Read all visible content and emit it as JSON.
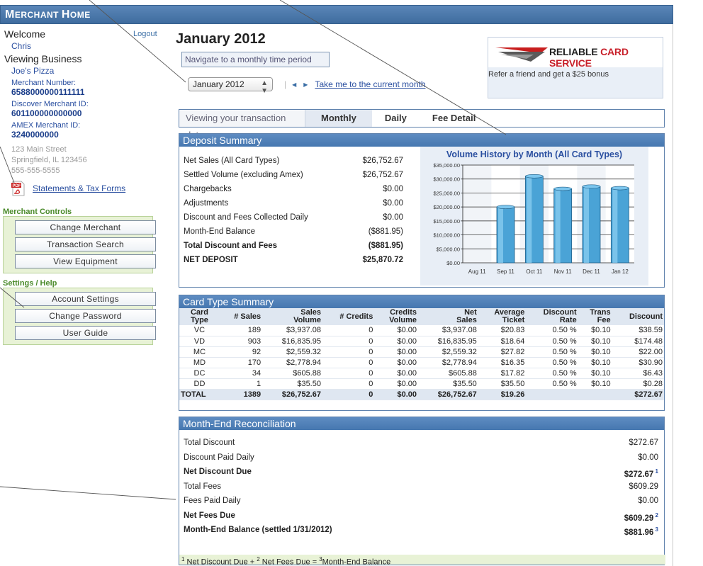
{
  "app": {
    "title_big": "M",
    "title_rest": "ERCHANT ",
    "title_big2": "H",
    "title_rest2": "OME"
  },
  "sidebar": {
    "welcome": "Welcome",
    "logout": "Logout",
    "user": "Chris",
    "viewing_business": "Viewing Business",
    "business_name": "Joe's Pizza",
    "merchant_number_label": "Merchant Number:",
    "merchant_number": "6588000000111111",
    "discover_label": "Discover Merchant ID:",
    "discover_id": "601100000000000",
    "amex_label": "AMEX Merchant ID:",
    "amex_id": "3240000000",
    "address1": "123 Main Street",
    "address2": "Springfield, IL 123456",
    "phone": "555-555-5555",
    "statements_link": "Statements & Tax Forms",
    "merchant_controls_title": "Merchant Controls",
    "merchant_controls": [
      "Change Merchant",
      "Transaction Search",
      "View Equipment"
    ],
    "settings_title": "Settings / Help",
    "settings": [
      "Account Settings",
      "Change Password",
      "User Guide"
    ]
  },
  "header": {
    "month_title": "January 2012",
    "nav_hint": "Navigate to a monthly time period",
    "month_select": "January 2012",
    "current_month_link": "Take me to the current month",
    "separator": "|"
  },
  "ad": {
    "brand1": "RELIABLE",
    "brand2": " CARD SERVICE",
    "tagline": "Refer a friend and get a $25 bonus"
  },
  "view_tabs": {
    "label": "Viewing your transaction data",
    "tabs": [
      "Monthly",
      "Daily",
      "Fee Detail"
    ],
    "active": "Monthly"
  },
  "deposit": {
    "title": "Deposit Summary",
    "rows": [
      {
        "label": "Net Sales (All Card Types)",
        "value": "$26,752.67"
      },
      {
        "label": "Settled Volume (excluding Amex)",
        "value": "$26,752.67"
      },
      {
        "label": "Chargebacks",
        "value": "$0.00"
      },
      {
        "label": "Adjustments",
        "value": "$0.00"
      },
      {
        "label": "Discount and Fees Collected Daily",
        "value": "$0.00"
      },
      {
        "label": "Month-End Balance",
        "value": "($881.95)"
      },
      {
        "label": "Total Discount and Fees",
        "value": "($881.95)"
      },
      {
        "label": "NET DEPOSIT",
        "value": "$25,870.72"
      }
    ]
  },
  "chart_data": {
    "type": "bar",
    "title": "Volume History by Month (All Card Types)",
    "categories": [
      "Aug 11",
      "Sep 11",
      "Oct 11",
      "Nov 11",
      "Dec 11",
      "Jan 12"
    ],
    "values": [
      0,
      20000,
      31000,
      26500,
      27300,
      26752.67
    ],
    "ylim": [
      0,
      35000
    ],
    "yticks": [
      "$0.00",
      "$5,000.00",
      "$10,000.00",
      "$15,000.00",
      "$20,000.00",
      "$25,000.00",
      "$30,000.00",
      "$35,000.00"
    ],
    "bar_color": "#4aa3d6",
    "grid": true
  },
  "cardtype": {
    "title": "Card Type Summary",
    "headers": [
      "Card\nType",
      "# Sales",
      "Sales\nVolume",
      "# Credits",
      "Credits\nVolume",
      "Net\nSales",
      "Average\nTicket",
      "Discount\nRate",
      "Trans\nFee",
      "Discount"
    ],
    "rows": [
      [
        "VC",
        "189",
        "$3,937.08",
        "0",
        "$0.00",
        "$3,937.08",
        "$20.83",
        "0.50 %",
        "$0.10",
        "$38.59"
      ],
      [
        "VD",
        "903",
        "$16,835.95",
        "0",
        "$0.00",
        "$16,835.95",
        "$18.64",
        "0.50 %",
        "$0.10",
        "$174.48"
      ],
      [
        "MC",
        "92",
        "$2,559.32",
        "0",
        "$0.00",
        "$2,559.32",
        "$27.82",
        "0.50 %",
        "$0.10",
        "$22.00"
      ],
      [
        "MD",
        "170",
        "$2,778.94",
        "0",
        "$0.00",
        "$2,778.94",
        "$16.35",
        "0.50 %",
        "$0.10",
        "$30.90"
      ],
      [
        "DC",
        "34",
        "$605.88",
        "0",
        "$0.00",
        "$605.88",
        "$17.82",
        "0.50 %",
        "$0.10",
        "$6.43"
      ],
      [
        "DD",
        "1",
        "$35.50",
        "0",
        "$0.00",
        "$35.50",
        "$35.50",
        "0.50 %",
        "$0.10",
        "$0.28"
      ]
    ],
    "total": [
      "TOTAL",
      "1389",
      "$26,752.67",
      "0",
      "$0.00",
      "$26,752.67",
      "$19.26",
      "",
      "",
      "$272.67"
    ]
  },
  "recon": {
    "title": "Month-End Reconciliation",
    "rows": [
      {
        "label": "Total Discount",
        "value": "$272.67",
        "sup": "",
        "bold": false
      },
      {
        "label": "Discount Paid Daily",
        "value": "$0.00",
        "sup": "",
        "bold": false
      },
      {
        "label": "Net Discount Due",
        "value": "$272.67",
        "sup": "1",
        "bold": true
      },
      {
        "label": "Total Fees",
        "value": "$609.29",
        "sup": "",
        "bold": false
      },
      {
        "label": "Fees Paid Daily",
        "value": "$0.00",
        "sup": "",
        "bold": false
      },
      {
        "label": "Net Fees Due",
        "value": "$609.29",
        "sup": "2",
        "bold": true
      },
      {
        "label": "Month-End Balance (settled 1/31/2012)",
        "value": "$881.96",
        "sup": "3",
        "bold": true
      }
    ],
    "footnote": {
      "s1": "1",
      "t1": " Net Discount Due + ",
      "s2": "2",
      "t2": " Net Fees Due = ",
      "s3": "3",
      "t3": "Month-End Balance"
    }
  }
}
